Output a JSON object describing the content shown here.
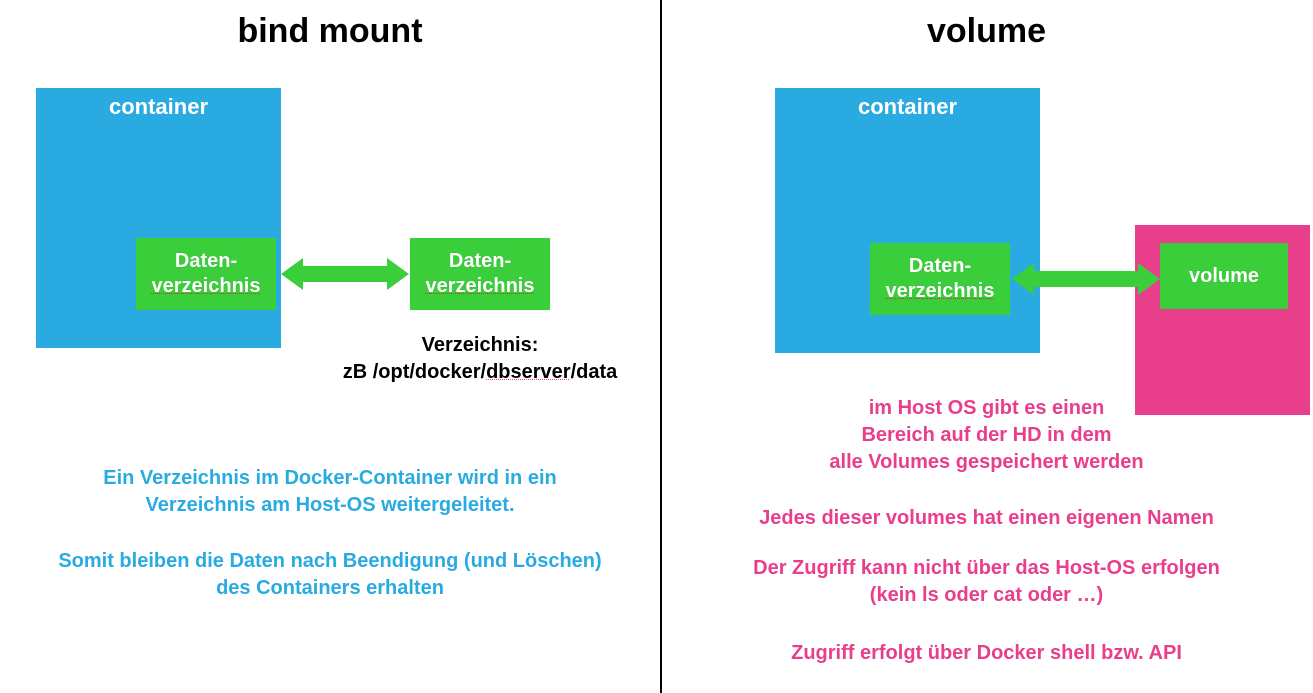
{
  "left": {
    "title": "bind mount",
    "container_label": "container",
    "inner_box_line1": "Daten-",
    "inner_box_line2": "verzeichnis",
    "outer_box_line1": "Daten-",
    "outer_box_line2": "verzeichnis",
    "path_label": "Verzeichnis:",
    "path_value_prefix": "zB /opt/docker/",
    "path_value_mid": "dbserver",
    "path_value_suffix": "/data",
    "desc1a": "Ein Verzeichnis im Docker-Container wird in ein",
    "desc1b": "Verzeichnis am Host-OS weitergeleitet.",
    "desc2a": "Somit bleiben die Daten nach Beendigung (und Löschen)",
    "desc2b": "des Containers erhalten"
  },
  "right": {
    "title": "volume",
    "container_label": "container",
    "inner_box_line1": "Daten-",
    "inner_box_line2": "verzeichnis",
    "volume_label": "volume",
    "desc1a": "im Host OS gibt es einen",
    "desc1b": "Bereich auf der HD in dem",
    "desc1c": "alle Volumes gespeichert werden",
    "desc2": "Jedes dieser volumes hat einen eigenen Namen",
    "desc3a": "Der Zugriff kann nicht über das Host-OS erfolgen",
    "desc3b": "(kein ls oder cat oder …)",
    "desc4": "Zugriff erfolgt über Docker shell bzw. API"
  }
}
